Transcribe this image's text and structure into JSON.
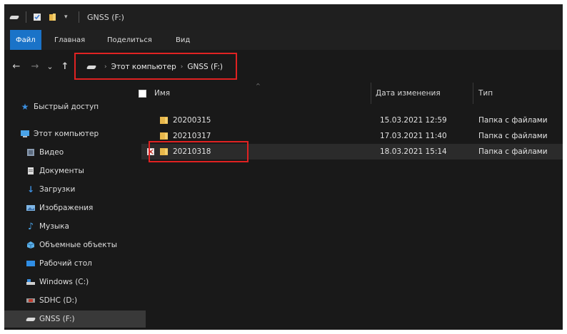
{
  "window": {
    "title": "GNSS (F:)"
  },
  "ribbon": {
    "tabs": [
      "Файл",
      "Главная",
      "Поделиться",
      "Вид"
    ]
  },
  "nav": {
    "back": "←",
    "forward": "→",
    "recent": "⌄",
    "up": "↑"
  },
  "address": {
    "crumbs": [
      "Этот компьютер",
      "GNSS (F:)"
    ]
  },
  "sidebar": {
    "items": [
      {
        "label": "Быстрый доступ",
        "icon": "star-icon"
      },
      {
        "label": "Этот компьютер",
        "icon": "computer-icon"
      },
      {
        "label": "Видео",
        "icon": "video-icon"
      },
      {
        "label": "Документы",
        "icon": "documents-icon"
      },
      {
        "label": "Загрузки",
        "icon": "download-icon"
      },
      {
        "label": "Изображения",
        "icon": "pictures-icon"
      },
      {
        "label": "Музыка",
        "icon": "music-icon"
      },
      {
        "label": "Объемные объекты",
        "icon": "3d-objects-icon"
      },
      {
        "label": "Рабочий стол",
        "icon": "desktop-icon"
      },
      {
        "label": "Windows (C:)",
        "icon": "drive-icon"
      },
      {
        "label": "SDHC (D:)",
        "icon": "sd-card-icon"
      },
      {
        "label": "GNSS (F:)",
        "icon": "drive-icon",
        "selected": true
      }
    ]
  },
  "columns": {
    "name": "Имя",
    "date": "Дата изменения",
    "type": "Тип"
  },
  "files": [
    {
      "name": "20200315",
      "date": "15.03.2021 12:59",
      "type": "Папка с файлами"
    },
    {
      "name": "20210317",
      "date": "17.03.2021 11:40",
      "type": "Папка с файлами"
    },
    {
      "name": "20210318",
      "date": "18.03.2021 15:14",
      "type": "Папка с файлами",
      "highlighted": true
    }
  ],
  "colors": {
    "accent": "#1a73c8",
    "background": "#191919",
    "annotation": "#e02222",
    "folder": "#e8b74a"
  }
}
